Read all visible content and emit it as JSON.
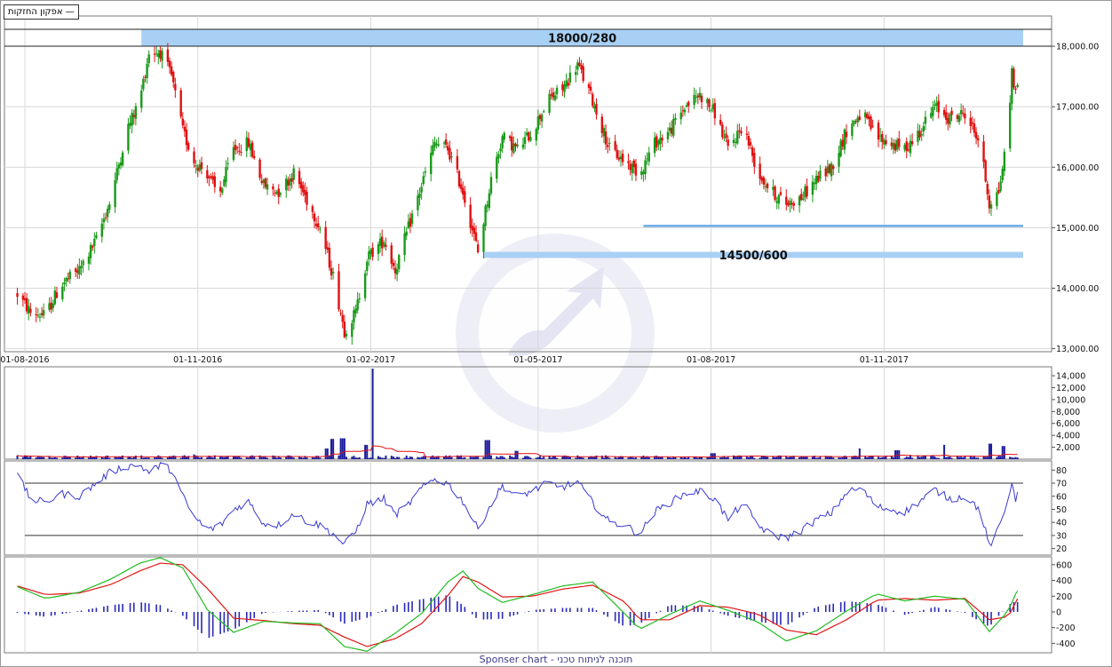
{
  "legend": {
    "label": "אפקון החזקות",
    "icon": "line-legend-icon"
  },
  "footer": {
    "text": "Sponser chart - תוכנה לניתוח טכני"
  },
  "colors": {
    "up": "#1a9a1a",
    "down": "#e01010",
    "volume": "#1c1c9c",
    "rsi": "#3a3ad0",
    "macd_fast": "#22bb22",
    "macd_slow": "#e01414",
    "histogram": "#2a2ab8",
    "zone": "#a8d0f5",
    "support_line": "#6aaae8"
  },
  "chart_data": [
    {
      "type": "candlestick",
      "x_ticks": [
        "01-08-2016",
        "01-11-2016",
        "01-02-2017",
        "01-05-2017",
        "01-08-2017",
        "01-11-2017"
      ],
      "y_ticks": [
        "13,000.00",
        "14,000.00",
        "15,000.00",
        "16,000.00",
        "17,000.00",
        "18,000.00"
      ],
      "ylim": [
        12950,
        18500
      ],
      "date_range": [
        "01-08-2016",
        "2018-01-14"
      ],
      "grid": true,
      "anchors": [
        [
          "2016-07-28",
          13900
        ],
        [
          "2016-08-04",
          13600
        ],
        [
          "2016-08-12",
          13550
        ],
        [
          "2016-08-20",
          14050
        ],
        [
          "2016-08-30",
          14300
        ],
        [
          "2016-09-08",
          14800
        ],
        [
          "2016-09-16",
          15500
        ],
        [
          "2016-09-24",
          16600
        ],
        [
          "2016-10-01",
          17100
        ],
        [
          "2016-10-06",
          17900
        ],
        [
          "2016-10-12",
          17900
        ],
        [
          "2016-10-18",
          17500
        ],
        [
          "2016-10-24",
          16600
        ],
        [
          "2016-10-30",
          16100
        ],
        [
          "2016-11-06",
          15900
        ],
        [
          "2016-11-12",
          15500
        ],
        [
          "2016-11-20",
          16300
        ],
        [
          "2016-11-28",
          16400
        ],
        [
          "2016-12-06",
          15700
        ],
        [
          "2016-12-14",
          15600
        ],
        [
          "2016-12-22",
          15900
        ],
        [
          "2016-12-30",
          15400
        ],
        [
          "2017-01-05",
          15000
        ],
        [
          "2017-01-12",
          14200
        ],
        [
          "2017-01-18",
          13300
        ],
        [
          "2017-01-24",
          13600
        ],
        [
          "2017-01-30",
          14500
        ],
        [
          "2017-02-08",
          14800
        ],
        [
          "2017-02-14",
          14300
        ],
        [
          "2017-02-20",
          14900
        ],
        [
          "2017-02-28",
          15700
        ],
        [
          "2017-03-07",
          16400
        ],
        [
          "2017-03-14",
          16300
        ],
        [
          "2017-03-22",
          15600
        ],
        [
          "2017-03-30",
          14600
        ],
        [
          "2017-04-06",
          15800
        ],
        [
          "2017-04-12",
          16500
        ],
        [
          "2017-04-20",
          16300
        ],
        [
          "2017-04-28",
          16600
        ],
        [
          "2017-05-06",
          17100
        ],
        [
          "2017-05-14",
          17300
        ],
        [
          "2017-05-22",
          17700
        ],
        [
          "2017-05-30",
          17100
        ],
        [
          "2017-06-08",
          16300
        ],
        [
          "2017-06-16",
          16100
        ],
        [
          "2017-06-24",
          15900
        ],
        [
          "2017-07-02",
          16400
        ],
        [
          "2017-07-10",
          16600
        ],
        [
          "2017-07-18",
          17000
        ],
        [
          "2017-07-26",
          17200
        ],
        [
          "2017-08-03",
          16900
        ],
        [
          "2017-08-10",
          16300
        ],
        [
          "2017-08-18",
          16700
        ],
        [
          "2017-08-26",
          15900
        ],
        [
          "2017-09-02",
          15600
        ],
        [
          "2017-09-10",
          15400
        ],
        [
          "2017-09-18",
          15500
        ],
        [
          "2017-09-26",
          15800
        ],
        [
          "2017-10-04",
          16000
        ],
        [
          "2017-10-12",
          16600
        ],
        [
          "2017-10-20",
          16900
        ],
        [
          "2017-10-28",
          16500
        ],
        [
          "2017-11-04",
          16400
        ],
        [
          "2017-11-12",
          16300
        ],
        [
          "2017-11-20",
          16600
        ],
        [
          "2017-11-28",
          17000
        ],
        [
          "2017-12-06",
          16800
        ],
        [
          "2017-12-14",
          16900
        ],
        [
          "2017-12-22",
          16400
        ],
        [
          "2017-12-27",
          15400
        ],
        [
          "2018-01-01",
          15600
        ],
        [
          "2018-01-06",
          16600
        ],
        [
          "2018-01-08",
          17600
        ],
        [
          "2018-01-10",
          17200
        ],
        [
          "2018-01-13",
          17800
        ]
      ],
      "annotations": [
        {
          "label": "18000/280",
          "y_low": 18000,
          "y_high": 18280,
          "x_from": "2016-10-02",
          "x_to": "2018-01-14"
        },
        {
          "label": "14500/600",
          "y_low": 14500,
          "y_high": 14600,
          "x_from": "2017-04-02",
          "x_to": "2018-01-14"
        },
        {
          "label": "",
          "y_value": 15030,
          "x_from": "2017-06-26",
          "x_to": "2018-01-14"
        }
      ]
    },
    {
      "type": "bar",
      "name": "volume",
      "y_ticks": [
        "2,000",
        "4,000",
        "6,000",
        "8,000",
        "10,000",
        "12,000",
        "14,000"
      ],
      "ylim": [
        0,
        15500
      ],
      "base_level": 500,
      "spikes": [
        [
          "2016-10-29",
          800
        ],
        [
          "2017-01-08",
          1800
        ],
        [
          "2017-01-12",
          3400
        ],
        [
          "2017-01-17",
          3500
        ],
        [
          "2017-01-29",
          2400
        ],
        [
          "2017-02-03",
          15200
        ],
        [
          "2017-04-04",
          3200
        ],
        [
          "2017-04-20",
          1400
        ],
        [
          "2017-08-02",
          1000
        ],
        [
          "2017-10-20",
          1800
        ],
        [
          "2017-11-08",
          1500
        ],
        [
          "2017-12-02",
          2400
        ],
        [
          "2017-12-28",
          2600
        ],
        [
          "2018-01-04",
          2200
        ]
      ],
      "average_color": "#e01010"
    },
    {
      "type": "line",
      "name": "RSI",
      "y_ticks": [
        "20",
        "30",
        "40",
        "50",
        "60",
        "70",
        "80"
      ],
      "ylim": [
        15,
        87
      ],
      "levels": [
        30,
        70
      ],
      "values": [
        [
          "2016-07-28",
          76
        ],
        [
          "2016-08-04",
          58
        ],
        [
          "2016-08-12",
          55
        ],
        [
          "2016-08-20",
          62
        ],
        [
          "2016-08-30",
          60
        ],
        [
          "2016-09-08",
          70
        ],
        [
          "2016-09-16",
          79
        ],
        [
          "2016-09-24",
          83
        ],
        [
          "2016-10-01",
          84
        ],
        [
          "2016-10-06",
          78
        ],
        [
          "2016-10-12",
          84
        ],
        [
          "2016-10-18",
          80
        ],
        [
          "2016-10-24",
          60
        ],
        [
          "2016-10-30",
          44
        ],
        [
          "2016-11-06",
          35
        ],
        [
          "2016-11-12",
          36
        ],
        [
          "2016-11-20",
          50
        ],
        [
          "2016-11-28",
          56
        ],
        [
          "2016-12-06",
          39
        ],
        [
          "2016-12-14",
          38
        ],
        [
          "2016-12-22",
          47
        ],
        [
          "2016-12-30",
          40
        ],
        [
          "2017-01-05",
          38
        ],
        [
          "2017-01-12",
          31
        ],
        [
          "2017-01-18",
          23
        ],
        [
          "2017-01-24",
          33
        ],
        [
          "2017-01-30",
          54
        ],
        [
          "2017-02-08",
          58
        ],
        [
          "2017-02-14",
          46
        ],
        [
          "2017-02-20",
          52
        ],
        [
          "2017-02-28",
          66
        ],
        [
          "2017-03-07",
          73
        ],
        [
          "2017-03-14",
          70
        ],
        [
          "2017-03-22",
          56
        ],
        [
          "2017-03-30",
          35
        ],
        [
          "2017-04-06",
          54
        ],
        [
          "2017-04-12",
          68
        ],
        [
          "2017-04-20",
          60
        ],
        [
          "2017-04-28",
          64
        ],
        [
          "2017-05-06",
          70
        ],
        [
          "2017-05-14",
          67
        ],
        [
          "2017-05-22",
          71
        ],
        [
          "2017-05-30",
          55
        ],
        [
          "2017-06-08",
          40
        ],
        [
          "2017-06-16",
          38
        ],
        [
          "2017-06-24",
          31
        ],
        [
          "2017-07-02",
          48
        ],
        [
          "2017-07-10",
          55
        ],
        [
          "2017-07-18",
          62
        ],
        [
          "2017-07-26",
          64
        ],
        [
          "2017-08-03",
          58
        ],
        [
          "2017-08-10",
          42
        ],
        [
          "2017-08-18",
          55
        ],
        [
          "2017-08-26",
          38
        ],
        [
          "2017-09-02",
          30
        ],
        [
          "2017-09-10",
          28
        ],
        [
          "2017-09-18",
          34
        ],
        [
          "2017-09-26",
          42
        ],
        [
          "2017-10-04",
          47
        ],
        [
          "2017-10-12",
          63
        ],
        [
          "2017-10-20",
          66
        ],
        [
          "2017-10-28",
          52
        ],
        [
          "2017-11-04",
          50
        ],
        [
          "2017-11-12",
          48
        ],
        [
          "2017-11-20",
          56
        ],
        [
          "2017-11-28",
          65
        ],
        [
          "2017-12-06",
          58
        ],
        [
          "2017-12-14",
          60
        ],
        [
          "2017-12-22",
          50
        ],
        [
          "2017-12-27",
          22
        ],
        [
          "2018-01-01",
          35
        ],
        [
          "2018-01-06",
          56
        ],
        [
          "2018-01-08",
          72
        ],
        [
          "2018-01-10",
          58
        ],
        [
          "2018-01-13",
          65
        ]
      ]
    },
    {
      "type": "line",
      "name": "MACD",
      "y_ticks": [
        "-400",
        "-200",
        "0",
        "200",
        "400",
        "600"
      ],
      "ylim": [
        -520,
        700
      ],
      "fast": [
        [
          "2016-07-28",
          320
        ],
        [
          "2016-08-12",
          170
        ],
        [
          "2016-08-30",
          250
        ],
        [
          "2016-09-16",
          420
        ],
        [
          "2016-10-01",
          620
        ],
        [
          "2016-10-12",
          690
        ],
        [
          "2016-10-24",
          560
        ],
        [
          "2016-11-06",
          30
        ],
        [
          "2016-11-20",
          -260
        ],
        [
          "2016-12-06",
          -120
        ],
        [
          "2016-12-22",
          -140
        ],
        [
          "2017-01-05",
          -150
        ],
        [
          "2017-01-18",
          -440
        ],
        [
          "2017-01-30",
          -500
        ],
        [
          "2017-02-14",
          -270
        ],
        [
          "2017-02-28",
          -20
        ],
        [
          "2017-03-14",
          380
        ],
        [
          "2017-03-22",
          520
        ],
        [
          "2017-03-30",
          300
        ],
        [
          "2017-04-12",
          120
        ],
        [
          "2017-04-28",
          220
        ],
        [
          "2017-05-14",
          330
        ],
        [
          "2017-05-30",
          380
        ],
        [
          "2017-06-16",
          -20
        ],
        [
          "2017-06-24",
          -220
        ],
        [
          "2017-07-10",
          -30
        ],
        [
          "2017-07-26",
          140
        ],
        [
          "2017-08-10",
          20
        ],
        [
          "2017-08-26",
          -130
        ],
        [
          "2017-09-10",
          -370
        ],
        [
          "2017-09-26",
          -240
        ],
        [
          "2017-10-12",
          10
        ],
        [
          "2017-10-28",
          230
        ],
        [
          "2017-11-12",
          140
        ],
        [
          "2017-11-28",
          200
        ],
        [
          "2017-12-14",
          160
        ],
        [
          "2017-12-27",
          -250
        ],
        [
          "2018-01-06",
          10
        ],
        [
          "2018-01-10",
          230
        ],
        [
          "2018-01-13",
          340
        ]
      ],
      "slow": [
        [
          "2016-07-28",
          330
        ],
        [
          "2016-08-12",
          220
        ],
        [
          "2016-08-30",
          240
        ],
        [
          "2016-09-16",
          350
        ],
        [
          "2016-10-01",
          520
        ],
        [
          "2016-10-12",
          620
        ],
        [
          "2016-10-24",
          600
        ],
        [
          "2016-11-06",
          300
        ],
        [
          "2016-11-20",
          -80
        ],
        [
          "2016-12-06",
          -110
        ],
        [
          "2016-12-22",
          -150
        ],
        [
          "2017-01-05",
          -170
        ],
        [
          "2017-01-18",
          -320
        ],
        [
          "2017-01-30",
          -440
        ],
        [
          "2017-02-14",
          -340
        ],
        [
          "2017-02-28",
          -150
        ],
        [
          "2017-03-14",
          210
        ],
        [
          "2017-03-22",
          450
        ],
        [
          "2017-03-30",
          380
        ],
        [
          "2017-04-12",
          190
        ],
        [
          "2017-04-28",
          200
        ],
        [
          "2017-05-14",
          290
        ],
        [
          "2017-05-30",
          340
        ],
        [
          "2017-06-16",
          130
        ],
        [
          "2017-06-24",
          -100
        ],
        [
          "2017-07-10",
          -100
        ],
        [
          "2017-07-26",
          80
        ],
        [
          "2017-08-10",
          60
        ],
        [
          "2017-08-26",
          -30
        ],
        [
          "2017-09-10",
          -230
        ],
        [
          "2017-09-26",
          -290
        ],
        [
          "2017-10-12",
          -100
        ],
        [
          "2017-10-28",
          150
        ],
        [
          "2017-11-12",
          170
        ],
        [
          "2017-11-28",
          150
        ],
        [
          "2017-12-14",
          170
        ],
        [
          "2017-12-27",
          -100
        ],
        [
          "2018-01-06",
          -60
        ],
        [
          "2018-01-10",
          120
        ],
        [
          "2018-01-13",
          260
        ]
      ]
    }
  ]
}
